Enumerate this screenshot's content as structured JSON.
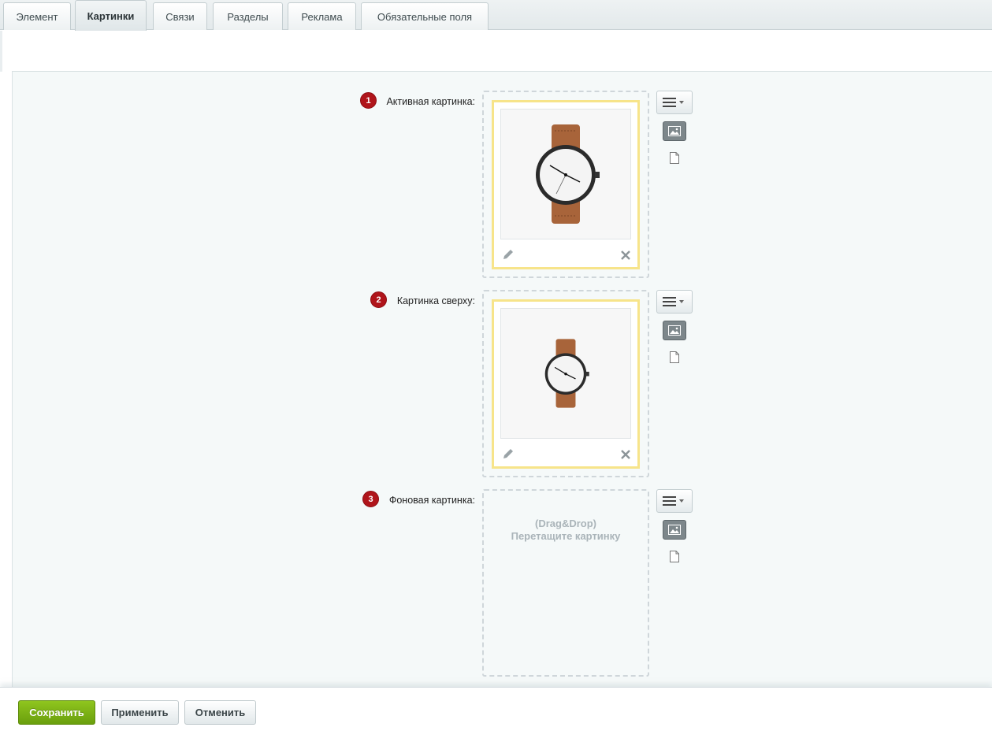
{
  "tabs": [
    {
      "label": "Элемент",
      "active": false
    },
    {
      "label": "Картинки",
      "active": true
    },
    {
      "label": "Связи",
      "active": false
    },
    {
      "label": "Разделы",
      "active": false
    },
    {
      "label": "Реклама",
      "active": false
    },
    {
      "label": "Обязательные поля",
      "active": false
    }
  ],
  "fields": [
    {
      "number": "1",
      "label": "Активная картинка:",
      "has_image": true
    },
    {
      "number": "2",
      "label": "Картинка сверху:",
      "has_image": true
    },
    {
      "number": "3",
      "label": "Фоновая картинка:",
      "has_image": false,
      "dropzone_line1": "(Drag&Drop)",
      "dropzone_line2": "Перетащите картинку"
    }
  ],
  "footer": {
    "save_label": "Сохранить",
    "apply_label": "Применить",
    "cancel_label": "Отменить"
  },
  "colors": {
    "badge": "#b0151b",
    "image_border": "#f7e48a",
    "save_button": "#7ab317",
    "panel_bg": "#f5f9f9"
  },
  "icons": {
    "menu": "hamburger-menu-icon",
    "image": "image-icon",
    "file": "file-icon",
    "edit": "pencil-icon",
    "delete": "close-icon"
  }
}
